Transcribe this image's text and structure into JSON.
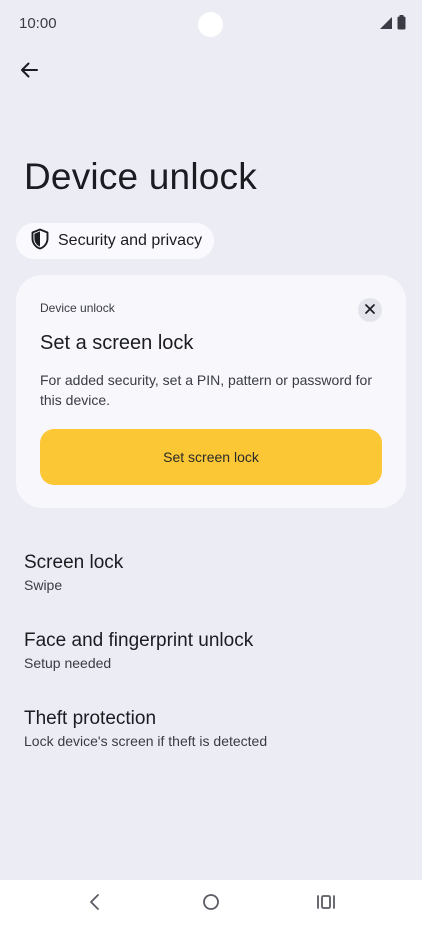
{
  "status_bar": {
    "time": "10:00",
    "icons": [
      "signal-icon",
      "battery-icon"
    ]
  },
  "header": {
    "back_icon": "back-arrow-icon",
    "title": "Device unlock"
  },
  "breadcrumb": {
    "icon": "shield-icon",
    "label": "Security and privacy"
  },
  "card": {
    "overline": "Device unlock",
    "title": "Set a screen lock",
    "description": "For added security, set a PIN, pattern or password for this device.",
    "button_label": "Set screen lock",
    "button_color": "#fcc735",
    "close_icon": "close-icon"
  },
  "settings": {
    "items": [
      {
        "title": "Screen lock",
        "subtitle": "Swipe"
      },
      {
        "title": "Face and fingerprint unlock",
        "subtitle": "Setup needed"
      },
      {
        "title": "Theft protection",
        "subtitle": "Lock device's screen if theft is detected"
      }
    ]
  },
  "nav_bar": {
    "icons": [
      "nav-back-icon",
      "nav-home-icon",
      "nav-recents-icon"
    ]
  },
  "colors": {
    "background": "#ecedf4",
    "card_background": "#f7f7fc",
    "accent": "#fcc735"
  }
}
